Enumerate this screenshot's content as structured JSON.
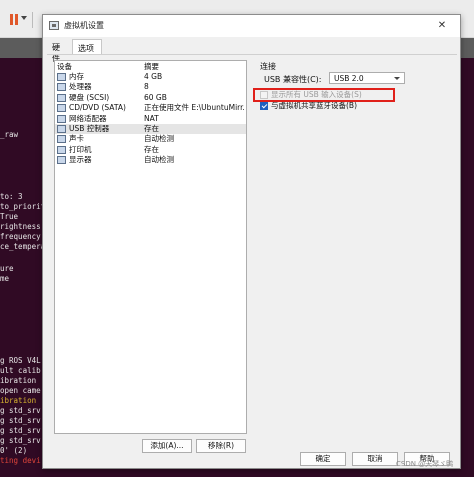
{
  "dialog": {
    "title": "虚拟机设置",
    "close_symbol": "✕"
  },
  "tabs": [
    "硬件",
    "选项"
  ],
  "device_table": {
    "headers": {
      "device": "设备",
      "summary": "摘要"
    },
    "rows": [
      {
        "device": "内存",
        "summary": "4 GB",
        "icon": "memory-icon"
      },
      {
        "device": "处理器",
        "summary": "8",
        "icon": "cpu-icon"
      },
      {
        "device": "硬盘 (SCSI)",
        "summary": "60 GB",
        "icon": "harddisk-icon"
      },
      {
        "device": "CD/DVD (SATA)",
        "summary": "正在使用文件 E:\\UbuntuMirr...",
        "icon": "cdrom-icon"
      },
      {
        "device": "网络适配器",
        "summary": "NAT",
        "icon": "network-icon"
      },
      {
        "device": "USB 控制器",
        "summary": "存在",
        "icon": "usb-icon",
        "selected": true
      },
      {
        "device": "声卡",
        "summary": "自动检测",
        "icon": "sound-icon"
      },
      {
        "device": "打印机",
        "summary": "存在",
        "icon": "printer-icon"
      },
      {
        "device": "显示器",
        "summary": "自动检测",
        "icon": "display-icon"
      }
    ]
  },
  "buttons": {
    "add": "添加(A)...",
    "remove": "移除(R)",
    "ok": "确定",
    "cancel": "取消",
    "help": "帮助"
  },
  "connection": {
    "group_label": "连接",
    "usb_compat_label": "USB 兼容性(C):",
    "usb_compat_value": "USB 2.0",
    "show_all_usb_label": "显示所有 USB 输入设备(S)",
    "show_all_usb_checked": false,
    "share_bluetooth_label": "与虚拟机共享蓝牙设备(B)",
    "share_bluetooth_checked": true
  },
  "terminal_lines": [
    {
      "text": "_raw",
      "kind": "normal"
    },
    {
      "text": "to: 3",
      "kind": "normal"
    },
    {
      "text": "to_priorit",
      "kind": "normal"
    },
    {
      "text": " True",
      "kind": "normal"
    },
    {
      "text": "rightness",
      "kind": "normal"
    },
    {
      "text": "frequency",
      "kind": "normal"
    },
    {
      "text": "ce_tempera",
      "kind": "normal"
    },
    {
      "text": "ure",
      "kind": "normal"
    },
    {
      "text": "me",
      "kind": "normal"
    },
    {
      "text": "g ROS V4L",
      "kind": "normal"
    },
    {
      "text": "ult calib",
      "kind": "normal"
    },
    {
      "text": "ibration",
      "kind": "normal"
    },
    {
      "text": "open came",
      "kind": "normal"
    },
    {
      "text": "ibration",
      "kind": "warn"
    },
    {
      "text": "g std_srv",
      "kind": "normal"
    },
    {
      "text": "g std_srv",
      "kind": "normal"
    },
    {
      "text": "g std_srv",
      "kind": "normal"
    },
    {
      "text": "g std_srv",
      "kind": "normal"
    },
    {
      "text": "0' (2)",
      "kind": "normal"
    },
    {
      "text": "ting devi",
      "kind": "err"
    }
  ],
  "watermark": "CSDN @天琴ゞ鸭"
}
